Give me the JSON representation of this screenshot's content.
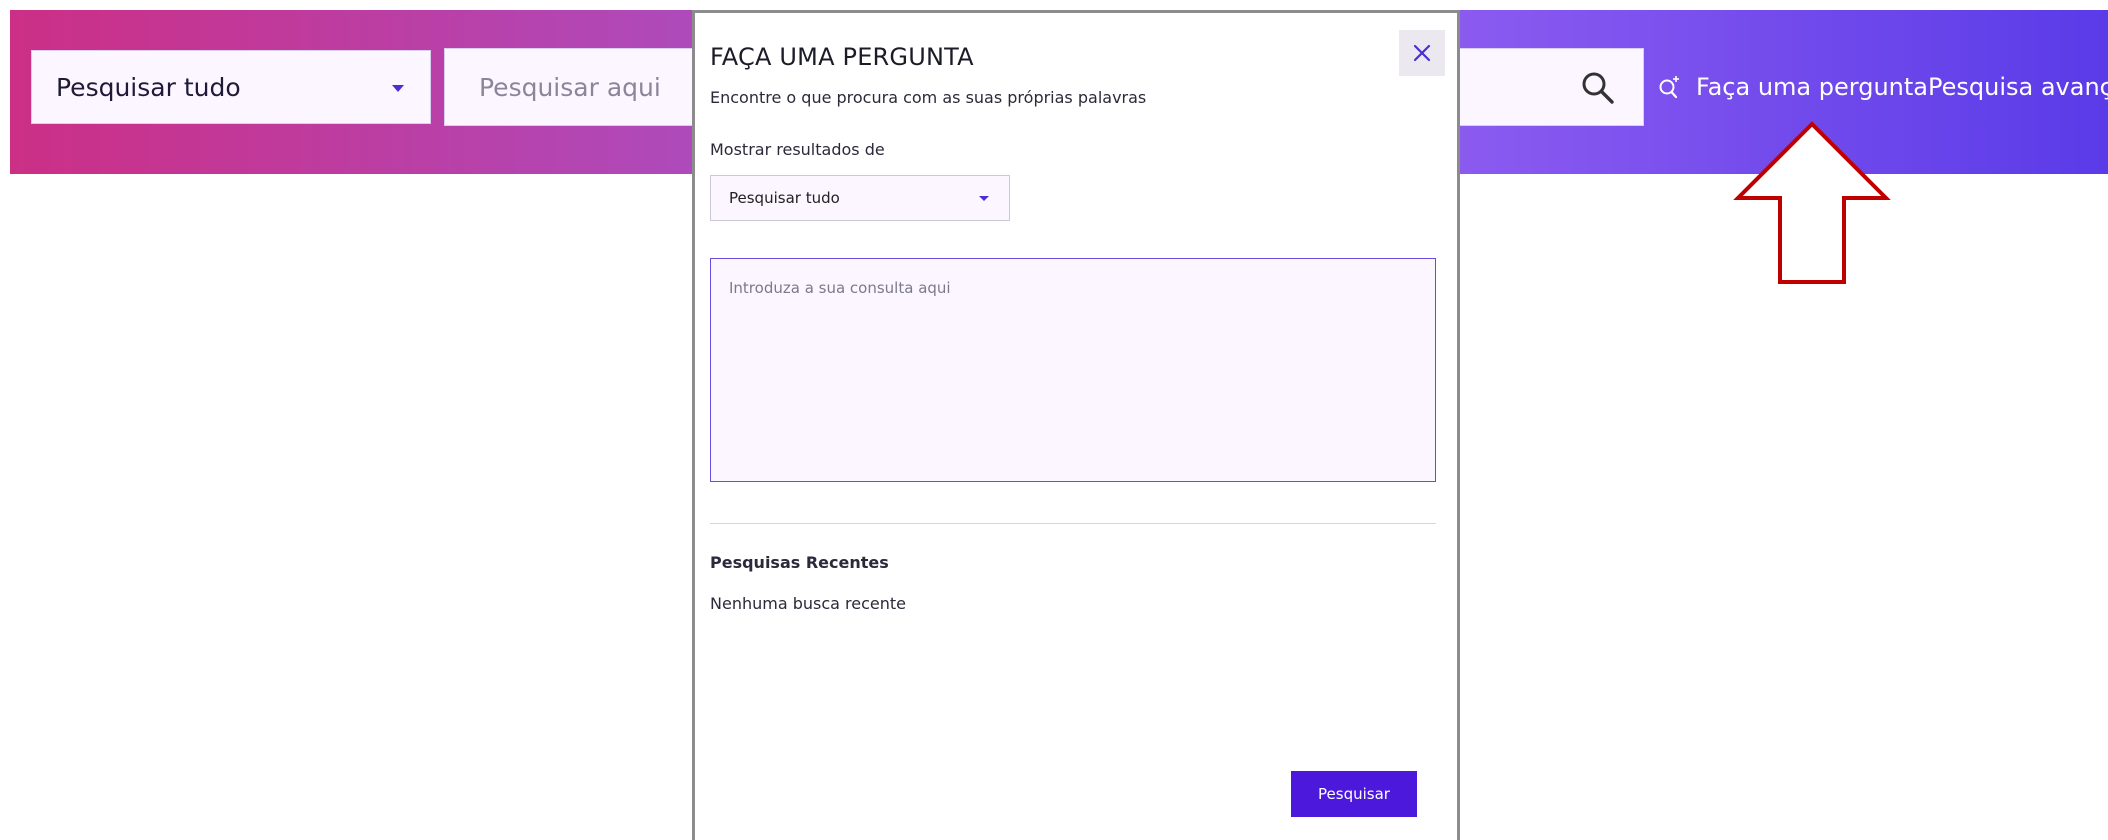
{
  "header": {
    "scope_select": {
      "value": "Pesquisar tudo"
    },
    "search": {
      "placeholder": "Pesquisar aqui"
    },
    "ask_link": "Faça uma pergunta",
    "advanced_link": "Pesquisa avançada"
  },
  "modal": {
    "title": "FAÇA UMA PERGUNTA",
    "subtitle": "Encontre o que procura com as suas próprias palavras",
    "results_label": "Mostrar resultados de",
    "scope_select": {
      "value": "Pesquisar tudo"
    },
    "query": {
      "placeholder": "Introduza a sua consulta aqui"
    },
    "recent_heading": "Pesquisas Recentes",
    "recent_empty": "Nenhuma busca recente",
    "submit_label": "Pesquisar"
  },
  "colors": {
    "header_gradient": [
      "#cc2f86",
      "#a94fc4",
      "#8a5af0",
      "#5a3be8"
    ],
    "accent": "#4b18dc",
    "annotation_arrow": "#c00000"
  },
  "icons": {
    "search": "search-icon",
    "ask": "sparkle-search-icon",
    "close": "close-icon",
    "caret": "caret-down-icon",
    "annotation": "up-arrow-annotation"
  }
}
